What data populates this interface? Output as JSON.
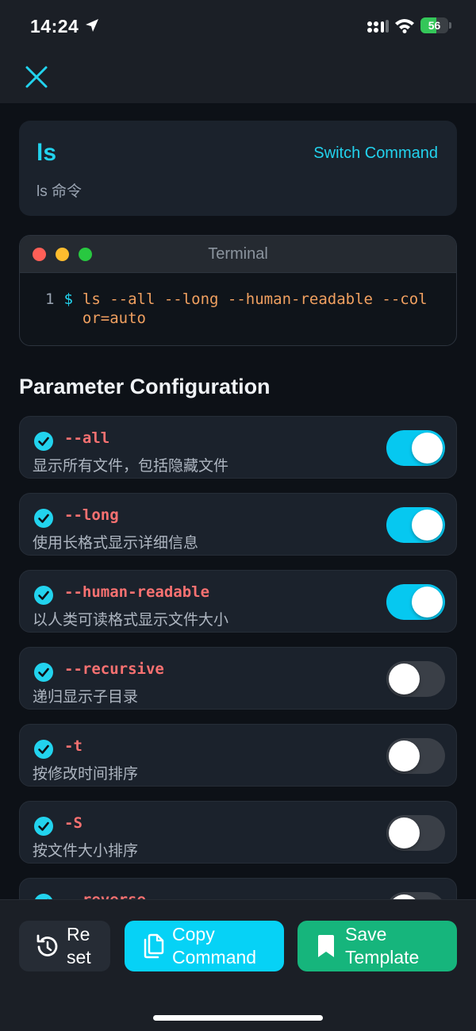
{
  "status": {
    "time": "14:24",
    "battery": "56",
    "battery_level": 0.56
  },
  "nav": {
    "close_icon": "close-icon"
  },
  "command": {
    "name": "ls",
    "description": "ls 命令",
    "switch_label": "Switch Command"
  },
  "terminal": {
    "title": "Terminal",
    "line_number": "1",
    "prompt": "$",
    "command_text": "ls --all --long --human-readable --color=auto"
  },
  "params_section": {
    "title": "Parameter Configuration"
  },
  "params": [
    {
      "flag": "--all",
      "description": "显示所有文件，包括隐藏文件",
      "enabled": true
    },
    {
      "flag": "--long",
      "description": "使用长格式显示详细信息",
      "enabled": true
    },
    {
      "flag": "--human-readable",
      "description": "以人类可读格式显示文件大小",
      "enabled": true
    },
    {
      "flag": "--recursive",
      "description": "递归显示子目录",
      "enabled": false
    },
    {
      "flag": "-t",
      "description": "按修改时间排序",
      "enabled": false
    },
    {
      "flag": "-S",
      "description": "按文件大小排序",
      "enabled": false
    },
    {
      "flag": "--reverse",
      "description": "",
      "enabled": false
    }
  ],
  "actions": {
    "reset_label": "Re set",
    "copy_label": "Copy Command",
    "save_label": "Save Template"
  },
  "colors": {
    "accent": "#22d3ee",
    "flag": "#f87171",
    "copy_button": "#06d2f6",
    "save_button": "#16b57c",
    "toggle_on": "#06c8f0"
  }
}
